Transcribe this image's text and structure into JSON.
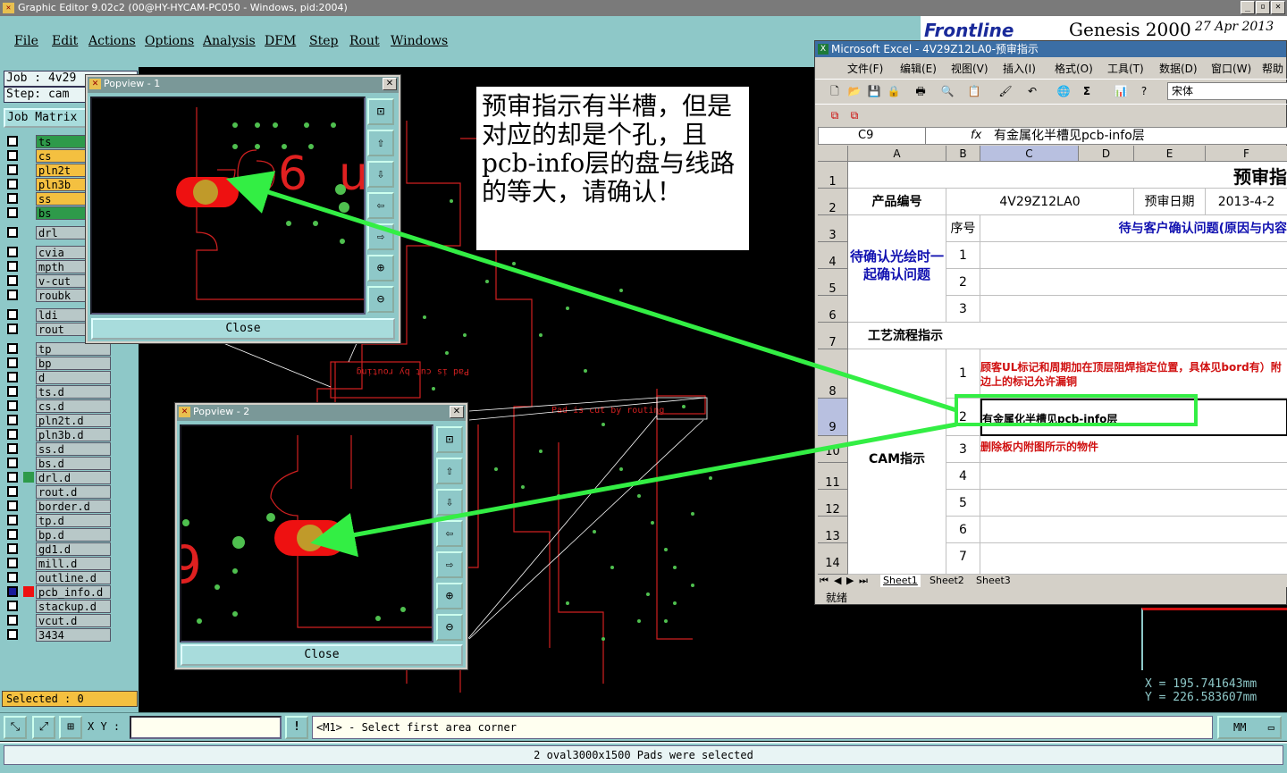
{
  "window": {
    "title": "Graphic Editor 9.02c2 (00@HY-HYCAM-PC050 - Windows, pid:2004)",
    "controls": {
      "minimize": "_",
      "maximize": "▫",
      "close": "✕"
    }
  },
  "menu": [
    "File",
    "Edit",
    "Actions",
    "Options",
    "Analysis",
    "DFM",
    "Step",
    "Rout",
    "Windows"
  ],
  "genesis": {
    "brand": "Frontline",
    "product": "Genesis 2000",
    "date": "27 Apr 2013"
  },
  "job": {
    "job_label": "Job : 4v29",
    "step_label": "Step: cam",
    "matrix_button": "Job Matrix"
  },
  "layers": [
    {
      "name": "ts",
      "color": "#2e9a4a"
    },
    {
      "name": "cs",
      "color": "#f4c040"
    },
    {
      "name": "pln2t",
      "color": "#f4c040"
    },
    {
      "name": "pln3b",
      "color": "#f4c040"
    },
    {
      "name": "ss",
      "color": "#f4c040"
    },
    {
      "name": "bs",
      "color": "#2e9a4a"
    },
    {
      "name": "drl",
      "color": "#b8c8c8"
    },
    {
      "name": "cvia",
      "color": "#b8c8c8"
    },
    {
      "name": "mpth",
      "color": "#b8c8c8"
    },
    {
      "name": "v-cut",
      "color": "#b8c8c8"
    },
    {
      "name": "roubk",
      "color": "#b8c8c8"
    },
    {
      "name": "ldi",
      "color": "#b8c8c8"
    },
    {
      "name": "rout",
      "color": "#b8c8c8"
    },
    {
      "name": "tp",
      "color": "#b8c8c8"
    },
    {
      "name": "bp",
      "color": "#b8c8c8"
    },
    {
      "name": "d",
      "color": "#b8c8c8"
    },
    {
      "name": "ts.d",
      "color": "#b8c8c8"
    },
    {
      "name": "cs.d",
      "color": "#b8c8c8"
    },
    {
      "name": "pln2t.d",
      "color": "#b8c8c8"
    },
    {
      "name": "pln3b.d",
      "color": "#b8c8c8"
    },
    {
      "name": "ss.d",
      "color": "#b8c8c8"
    },
    {
      "name": "bs.d",
      "color": "#b8c8c8"
    },
    {
      "name": "drl.d",
      "color": "#b8c8c8"
    },
    {
      "name": "rout.d",
      "color": "#b8c8c8"
    },
    {
      "name": "border.d",
      "color": "#b8c8c8"
    },
    {
      "name": "tp.d",
      "color": "#b8c8c8"
    },
    {
      "name": "bp.d",
      "color": "#b8c8c8"
    },
    {
      "name": "gd1.d",
      "color": "#b8c8c8"
    },
    {
      "name": "mill.d",
      "color": "#b8c8c8"
    },
    {
      "name": "outline.d",
      "color": "#b8c8c8"
    },
    {
      "name": "pcb_info.d",
      "color": "#b8c8c8"
    },
    {
      "name": "stackup.d",
      "color": "#b8c8c8"
    },
    {
      "name": "vcut.d",
      "color": "#b8c8c8"
    },
    {
      "name": "3434",
      "color": "#b8c8c8"
    }
  ],
  "selected": "Selected : 0",
  "popview1": {
    "title": "Popview - 1",
    "close_label": "Close"
  },
  "popview2": {
    "title": "Popview - 2",
    "close_label": "Close"
  },
  "canvas_text": {
    "routing1": "Pad is cut by routing",
    "routing2": "Pad is cut by routing"
  },
  "callout": "预审指示有半槽，但是对应的却是个孔，且pcb-info层的盘与线路的等大，请确认！",
  "excel": {
    "title": "Microsoft Excel - 4V29Z12LA0-预审指示",
    "menu": [
      "文件(F)",
      "编辑(E)",
      "视图(V)",
      "插入(I)",
      "格式(O)",
      "工具(T)",
      "数据(D)",
      "窗口(W)",
      "帮助"
    ],
    "font_name": "宋体",
    "name_box": "C9",
    "formula_label": "fx",
    "formula": "有金属化半槽见pcb-info层",
    "columns": [
      "A",
      "B",
      "C",
      "D",
      "E",
      "F"
    ],
    "rows": [
      "1",
      "2",
      "3",
      "4",
      "5",
      "6",
      "7",
      "8",
      "9",
      "10",
      "11",
      "12",
      "13",
      "14"
    ],
    "title_cell": "预审指",
    "product_label": "产品编号",
    "product_no": "4V29Z12LA0",
    "date_label": "预审日期",
    "date_value": "2013-4-2",
    "seq_header": "序号",
    "issue_header": "待与客户确认问题(原因与内容",
    "confirm_label": "待确认光绘时一起确认问题",
    "seq": [
      "1",
      "2",
      "3"
    ],
    "process_label": "工艺流程指示",
    "cam_label": "CAM指示",
    "cam_items": [
      "1",
      "2",
      "3",
      "4",
      "5",
      "6",
      "7"
    ],
    "cam_item1": "顾客UL标记和周期加在顶层阻焊指定位置，具体见bord有）附边上的标记允许漏铜",
    "cam_item2": "有金属化半槽见pcb-info层",
    "cam_item3": "删除板内附图所示的物件",
    "sheets": [
      "Sheet1",
      "Sheet2",
      "Sheet3"
    ],
    "status": "就绪"
  },
  "coords": {
    "x": "X  =  195.741643mm",
    "y": "Y  =  226.583607mm"
  },
  "bottom": {
    "xy_label": "X Y :",
    "prompt": "<M1> - Select first area corner",
    "unit": "MM",
    "warn": "!"
  },
  "status_message": "2 oval3000x1500 Pads were selected"
}
